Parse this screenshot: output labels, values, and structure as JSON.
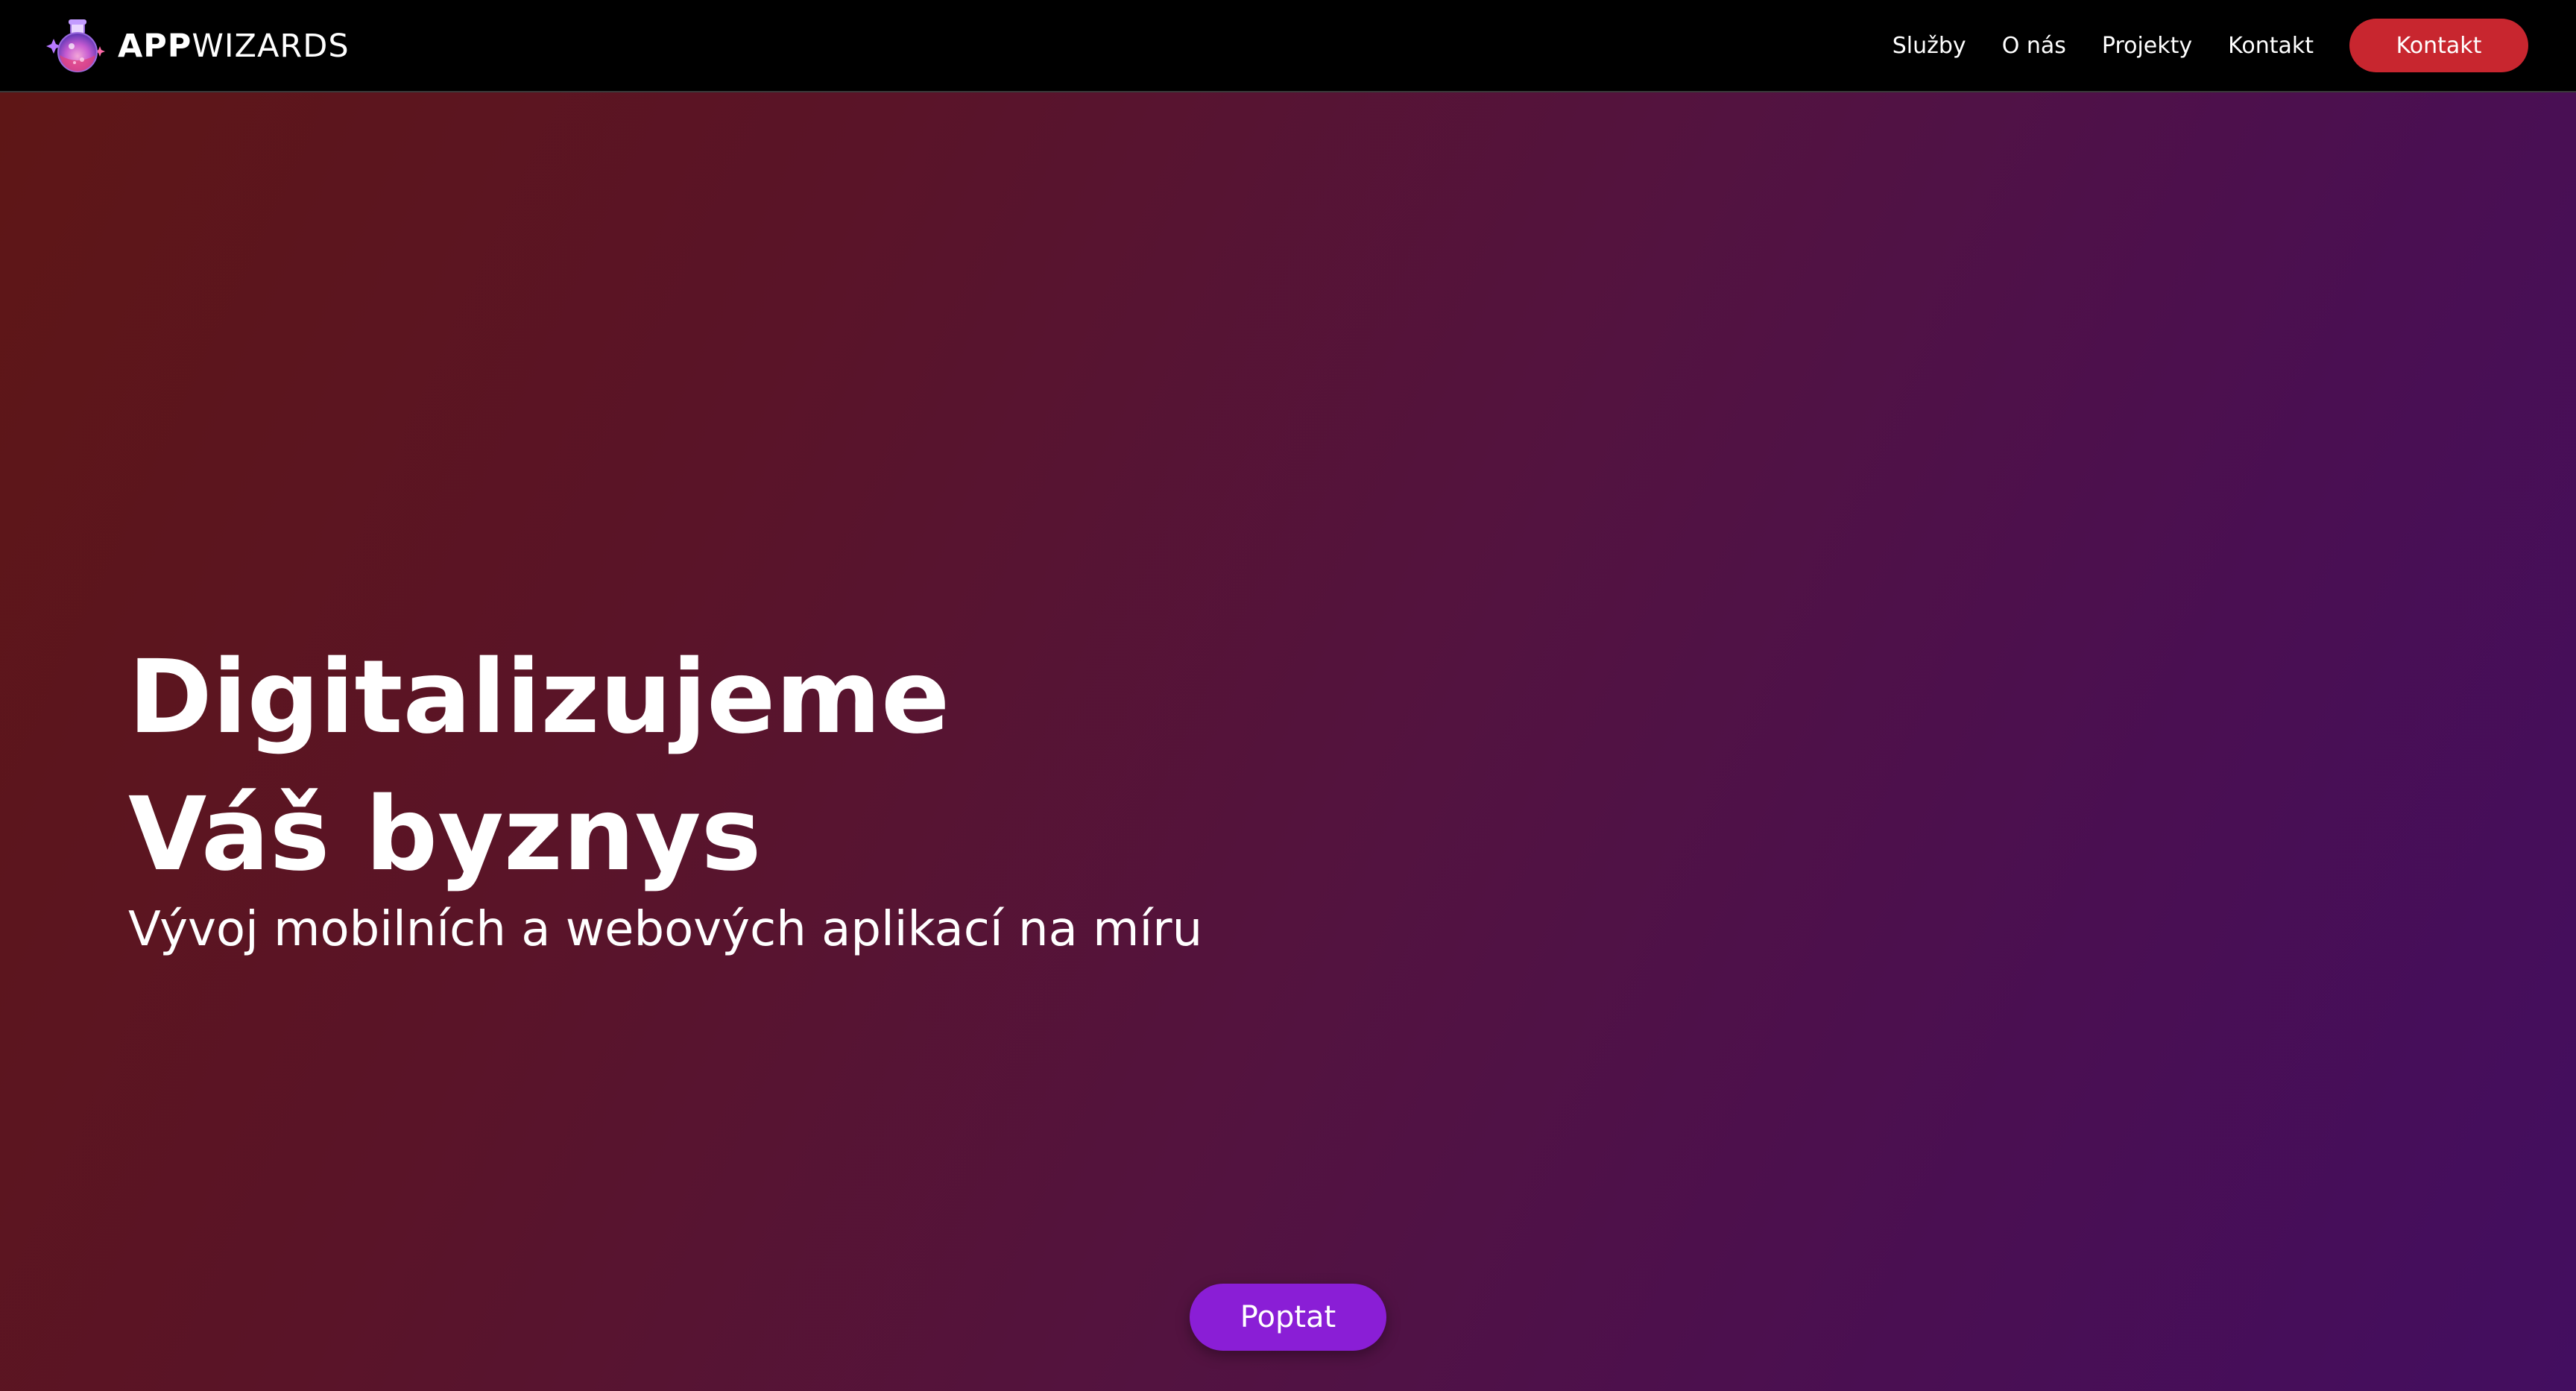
{
  "brand": {
    "name_bold": "APP",
    "name_light": "WIZARDS",
    "icon": "potion-flask-logo-icon"
  },
  "nav": {
    "links": [
      {
        "label": "Služby"
      },
      {
        "label": "O nás"
      },
      {
        "label": "Projekty"
      },
      {
        "label": "Kontakt"
      }
    ],
    "cta_label": "Kontakt"
  },
  "hero": {
    "title_line1": "Digitalizujeme",
    "title_line2": "Váš byznys",
    "subtitle": "Vývoj mobilních a webových aplikací na míru",
    "cta_label": "Poptat"
  },
  "colors": {
    "nav_background": "#000000",
    "nav_cta": "#c8262f",
    "hero_cta": "#8a1ed6",
    "gradient_start": "#5e1616",
    "gradient_end": "#430e60"
  }
}
